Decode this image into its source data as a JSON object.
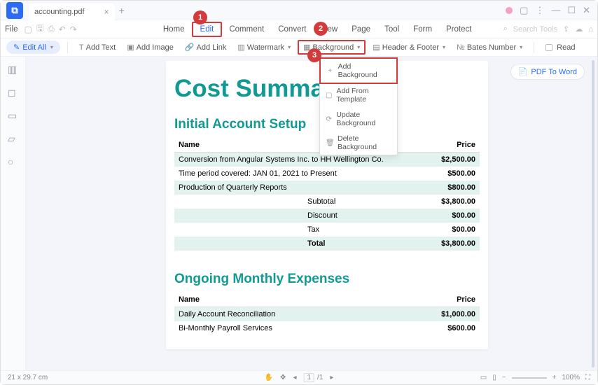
{
  "titlebar": {
    "tab_name": "accounting.pdf"
  },
  "menubar": {
    "file": "File",
    "items": [
      "Home",
      "Edit",
      "Comment",
      "Convert",
      "View",
      "Page",
      "Tool",
      "Form",
      "Protect"
    ],
    "search_placeholder": "Search Tools"
  },
  "toolbar": {
    "edit_all": "Edit All",
    "add_text": "Add Text",
    "add_image": "Add Image",
    "add_link": "Add Link",
    "watermark": "Watermark",
    "background": "Background",
    "header_footer": "Header & Footer",
    "bates": "Bates Number",
    "read": "Read"
  },
  "dropdown": {
    "add_bg": "Add Background",
    "from_template": "Add From Template",
    "update_bg": "Update Background",
    "delete_bg": "Delete Background"
  },
  "right_panel": {
    "pdf_to_word": "PDF To Word"
  },
  "doc": {
    "title": "Cost Summary",
    "section1": "Initial Account Setup",
    "col_name": "Name",
    "col_price": "Price",
    "rows1": [
      {
        "name": "Conversion from Angular Systems Inc. to HH Wellington Co.",
        "price": "$2,500.00"
      },
      {
        "name": "Time period covered: JAN 01, 2021 to Present",
        "price": "$500.00"
      },
      {
        "name": "Production of Quarterly Reports",
        "price": "$800.00"
      }
    ],
    "subtotal_label": "Subtotal",
    "subtotal": "$3,800.00",
    "discount_label": "Discount",
    "discount": "$00.00",
    "tax_label": "Tax",
    "tax": "$00.00",
    "total_label": "Total",
    "total": "$3,800.00",
    "section2": "Ongoing Monthly Expenses",
    "rows2": [
      {
        "name": "Daily Account Reconciliation",
        "price": "$1,000.00"
      },
      {
        "name": "Bi-Monthly Payroll Services",
        "price": "$600.00"
      }
    ]
  },
  "callouts": {
    "c1": "1",
    "c2": "2",
    "c3": "3"
  },
  "status": {
    "left": "21 x 29.7 cm",
    "page_current": "1",
    "page_total": "/1",
    "zoom": "100%"
  }
}
